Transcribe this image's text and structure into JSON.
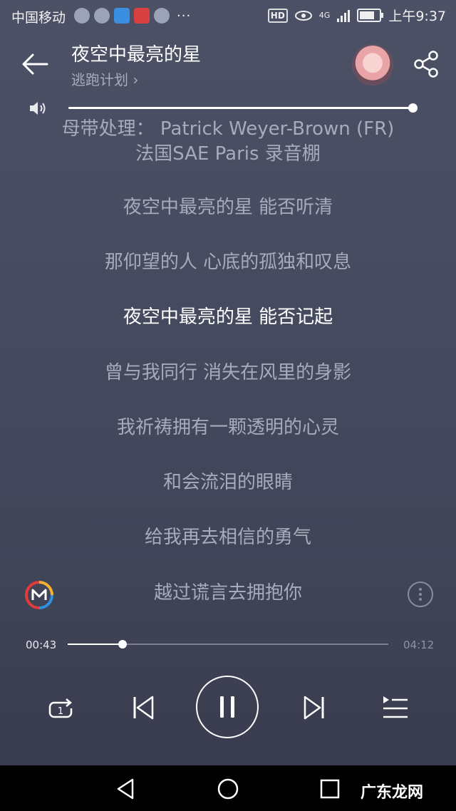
{
  "status_bar": {
    "carrier": "中国移动",
    "extra": "···",
    "hd": "HD",
    "network": "4G",
    "time": "上午9:37"
  },
  "header": {
    "title": "夜空中最亮的星",
    "artist": "逃跑计划 ›"
  },
  "volume": {
    "level": 1.0
  },
  "lyrics": [
    {
      "text": "母带处理： Patrick Weyer-Brown (FR)",
      "active": false
    },
    {
      "text": "法国SAE Paris 录音棚",
      "active": false
    },
    {
      "text": "夜空中最亮的星 能否听清",
      "active": false
    },
    {
      "text": "那仰望的人 心底的孤独和叹息",
      "active": false
    },
    {
      "text": "夜空中最亮的星 能否记起",
      "active": true
    },
    {
      "text": "曾与我同行 消失在风里的身影",
      "active": false
    },
    {
      "text": "我祈祷拥有一颗透明的心灵",
      "active": false
    },
    {
      "text": "和会流泪的眼睛",
      "active": false
    },
    {
      "text": "给我再去相信的勇气",
      "active": false
    },
    {
      "text": "越过谎言去拥抱你",
      "active": false
    }
  ],
  "progress": {
    "elapsed": "00:43",
    "total": "04:12",
    "fraction": 0.17
  },
  "controls": {
    "repeat_badge": "1"
  },
  "watermark": "广东龙网",
  "colors": {
    "active_lyric": "#ffffff",
    "inactive_lyric": "#a8abb9",
    "brand_red": "#e23b3b",
    "brand_blue": "#2f8fe0",
    "brand_yellow": "#f2b230"
  }
}
